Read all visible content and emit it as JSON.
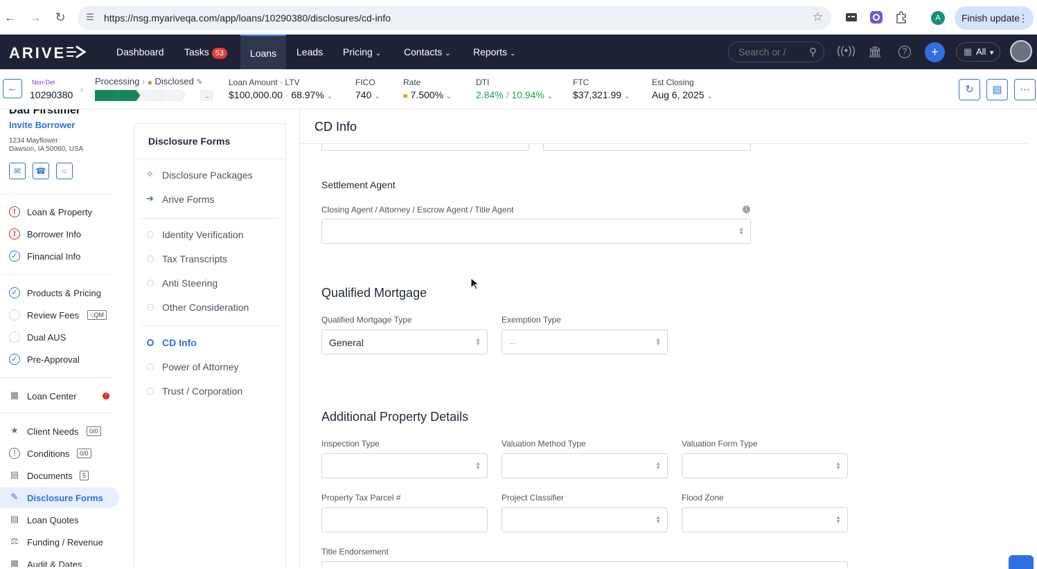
{
  "browser": {
    "url": "https://nsg.myariveqa.com/app/loans/10290380/disclosures/cd-info",
    "profile_initial": "A",
    "finish_update": "Finish update"
  },
  "appnav": {
    "logo": "ARIVE",
    "items": [
      {
        "label": "Dashboard"
      },
      {
        "label": "Tasks",
        "badge": "53"
      },
      {
        "label": "Loans",
        "active": true
      },
      {
        "label": "Leads"
      },
      {
        "label": "Pricing"
      },
      {
        "label": "Contacts"
      },
      {
        "label": "Reports"
      }
    ],
    "search_placeholder": "Search or /",
    "scope": "All"
  },
  "loan": {
    "channel": "Non-Del",
    "number": "10290380",
    "stage": "Processing",
    "status": "Disclosed",
    "loan_amount_label": "Loan Amount",
    "ltv_label": "LTV",
    "loan_amount": "$100,000.00",
    "ltv": "68.97%",
    "fico_label": "FICO",
    "fico": "740",
    "rate_label": "Rate",
    "rate": "7.500%",
    "dti_label": "DTI",
    "dti_front": "2.84%",
    "dti_back": "10.94%",
    "ftc_label": "FTC",
    "ftc": "$37,321.99",
    "closing_label": "Est Closing",
    "closing": "Aug 6, 2025"
  },
  "borrower": {
    "name": "Dad Firstimer",
    "invite": "Invite Borrower",
    "addr1": "1234 Mayflower",
    "addr2": "Dawson, IA 50060, USA"
  },
  "sidebar": {
    "items": [
      {
        "label": "Loan & Property",
        "icon": "warning-icon"
      },
      {
        "label": "Borrower Info",
        "icon": "warning-icon"
      },
      {
        "label": "Financial Info",
        "icon": "check-icon"
      },
      {
        "label": "Products & Pricing",
        "icon": "check-icon"
      },
      {
        "label": "Review Fees",
        "icon": "empty-circle-icon",
        "badge": "QM"
      },
      {
        "label": "Dual AUS",
        "icon": "empty-circle-icon"
      },
      {
        "label": "Pre-Approval",
        "icon": "check-icon"
      },
      {
        "label": "Loan Center",
        "icon": "layout-icon",
        "alert": "!"
      },
      {
        "label": "Client Needs",
        "icon": "network-icon",
        "badge": "0/0"
      },
      {
        "label": "Conditions",
        "icon": "alert-circle-icon",
        "badge": "0/0"
      },
      {
        "label": "Documents",
        "icon": "documents-icon",
        "badge": "5"
      },
      {
        "label": "Disclosure Forms",
        "icon": "signature-icon",
        "selected": true
      },
      {
        "label": "Loan Quotes",
        "icon": "quote-icon"
      },
      {
        "label": "Funding / Revenue",
        "icon": "funding-icon"
      },
      {
        "label": "Audit & Dates",
        "icon": "calendar-icon"
      }
    ]
  },
  "disclosure_panel": {
    "title": "Disclosure Forms",
    "top_items": [
      {
        "label": "Disclosure Packages"
      },
      {
        "label": "Arive Forms"
      }
    ],
    "items": [
      {
        "label": "Identity Verification"
      },
      {
        "label": "Tax Transcripts"
      },
      {
        "label": "Anti Steering"
      },
      {
        "label": "Other Consideration"
      }
    ],
    "items2": [
      {
        "label": "CD Info",
        "active": true
      },
      {
        "label": "Power of Attorney"
      },
      {
        "label": "Trust / Corporation"
      }
    ]
  },
  "main": {
    "title": "CD Info",
    "settlement": {
      "title": "Settlement Agent",
      "agent_label": "Closing Agent / Attorney / Escrow Agent / Title Agent",
      "agent_value": ""
    },
    "qm": {
      "title": "Qualified Mortgage",
      "type_label": "Qualified Mortgage Type",
      "type_value": "General",
      "exemption_label": "Exemption Type",
      "exemption_value": "--"
    },
    "property": {
      "title": "Additional Property Details",
      "inspection_label": "Inspection Type",
      "valuation_method_label": "Valuation Method Type",
      "valuation_form_label": "Valuation Form Type",
      "parcel_label": "Property Tax Parcel #",
      "project_label": "Project Classifier",
      "flood_label": "Flood Zone",
      "title_endorsement_label": "Title Endorsement"
    }
  }
}
